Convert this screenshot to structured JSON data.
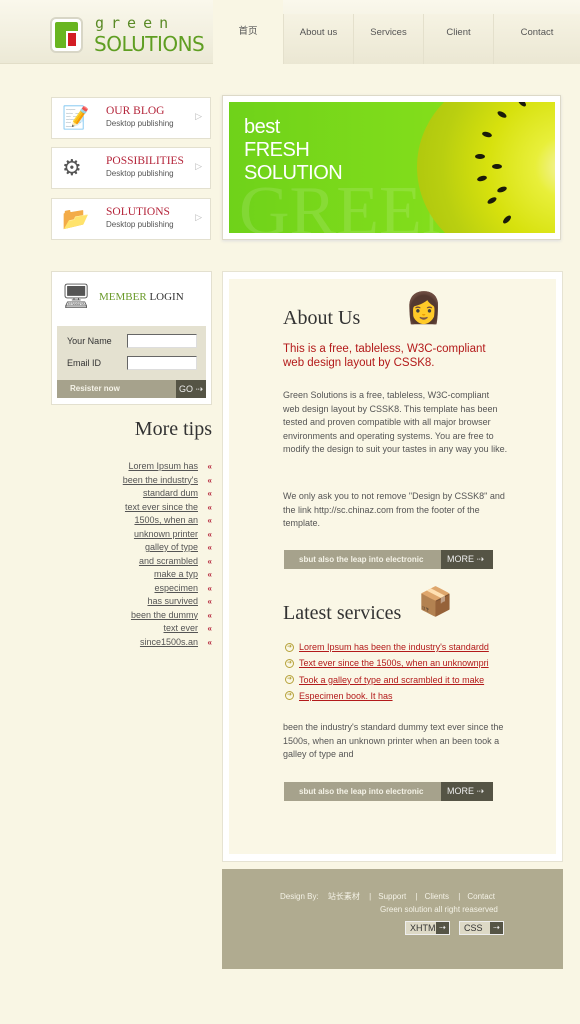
{
  "logo": {
    "line1": "green",
    "line2": "SOLUTIONS"
  },
  "nav": [
    {
      "label": "首页",
      "active": true
    },
    {
      "label": "About us"
    },
    {
      "label": "Services"
    },
    {
      "label": "Client"
    },
    {
      "label": "Contact"
    }
  ],
  "side_items": [
    {
      "title": "OUR BLOG",
      "subtitle": "Desktop publishing",
      "icon": "blog-icon"
    },
    {
      "title": "POSSIBILITIES",
      "subtitle": "Desktop publishing",
      "icon": "gears-icon"
    },
    {
      "title": "SOLUTIONS",
      "subtitle": "Desktop publishing",
      "icon": "folder-icon"
    }
  ],
  "banner": {
    "line1": "best",
    "line2": "FRESH",
    "line3": "SOLUTION",
    "bg_word": "GREEN"
  },
  "login": {
    "title_a": "MEMBER",
    "title_b": "LOGIN",
    "name_label": "Your Name",
    "email_label": "Email ID",
    "name_value": "",
    "email_value": "",
    "register": "Resister now",
    "go": "GO"
  },
  "tips": {
    "title": "More tips",
    "items": [
      "Lorem Ipsum has",
      "been the industry's",
      "standard dum",
      "text ever since the",
      "1500s, when an",
      "unknown printer",
      "galley of type",
      "and scrambled",
      "make a typ",
      "especimen",
      "has survived",
      "been the dummy",
      "text ever",
      "since1500s.an"
    ]
  },
  "about": {
    "title": "About Us",
    "lead": "This is a free, tableless, W3C-compliant web design layout by CSSK8.",
    "p1": "Green Solutions is a free, tableless, W3C-compliant web design layout by CSSK8. This template has been tested and proven compatible with all major browser environments and operating systems. You are free to modify the design to suit your tastes in any way you like.",
    "p2": "We only ask you to not remove \"Design by CSSK8\" and the link http://sc.chinaz.com from the footer of the template.",
    "more_text": "sbut also the leap into electronic",
    "more": "MORE"
  },
  "services": {
    "title": "Latest services",
    "items": [
      "Lorem Ipsum has been the industry's standardd",
      "Text ever since the 1500s, when an unknownpri",
      "Took a galley of type and scrambled it to make",
      "Especimen book. It has"
    ],
    "p": "been the industry's standard dummy text ever since the 1500s, when an unknown printer when an been took a galley of type and",
    "more_text": "sbut also the leap into electronic",
    "more": "MORE"
  },
  "footer": {
    "design": "Design By:",
    "designer": "站长素材",
    "links": [
      "Support",
      "Clients",
      "Contact"
    ],
    "copyright": "Green solution all right reaserved",
    "badges": [
      "XHTML",
      "CSS"
    ]
  },
  "colors": {
    "bg": "#f9f6e4",
    "accent_green": "#5f9e22",
    "accent_red": "#b31a1a",
    "footer": "#b0ab90"
  }
}
